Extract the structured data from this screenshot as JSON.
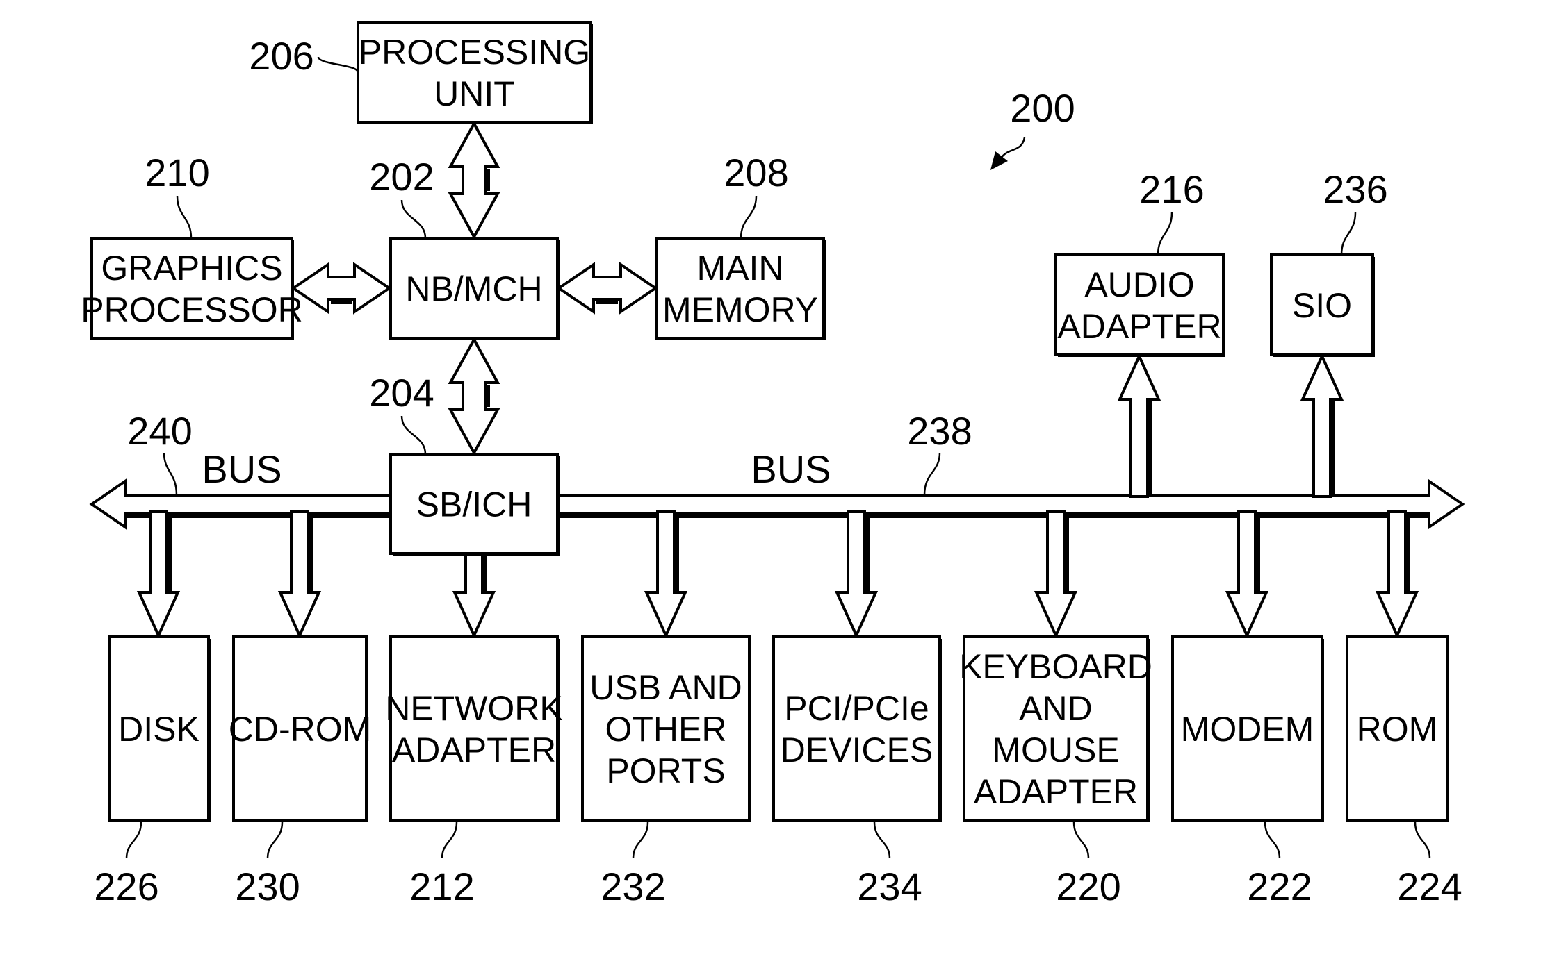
{
  "figure": {
    "ref": "200",
    "blocks": [
      {
        "id": "processing_unit",
        "ref": "206",
        "lines": [
          "PROCESSING",
          "UNIT"
        ]
      },
      {
        "id": "graphics_processor",
        "ref": "210",
        "lines": [
          "GRAPHICS",
          "PROCESSOR"
        ]
      },
      {
        "id": "nb_mch",
        "ref": "202",
        "lines": [
          "NB/MCH"
        ]
      },
      {
        "id": "main_memory",
        "ref": "208",
        "lines": [
          "MAIN",
          "MEMORY"
        ]
      },
      {
        "id": "audio_adapter",
        "ref": "216",
        "lines": [
          "AUDIO",
          "ADAPTER"
        ]
      },
      {
        "id": "sio",
        "ref": "236",
        "lines": [
          "SIO"
        ]
      },
      {
        "id": "sb_ich",
        "ref": "204",
        "lines": [
          "SB/ICH"
        ]
      },
      {
        "id": "disk",
        "ref": "226",
        "lines": [
          "DISK"
        ]
      },
      {
        "id": "cd_rom",
        "ref": "230",
        "lines": [
          "CD-ROM"
        ]
      },
      {
        "id": "network_adapter",
        "ref": "212",
        "lines": [
          "NETWORK",
          "ADAPTER"
        ]
      },
      {
        "id": "usb_ports",
        "ref": "232",
        "lines": [
          "USB AND",
          "OTHER",
          "PORTS"
        ]
      },
      {
        "id": "pci_devices",
        "ref": "234",
        "lines": [
          "PCI/PCIe",
          "DEVICES"
        ]
      },
      {
        "id": "keyboard_mouse",
        "ref": "220",
        "lines": [
          "KEYBOARD",
          "AND",
          "MOUSE",
          "ADAPTER"
        ]
      },
      {
        "id": "modem",
        "ref": "222",
        "lines": [
          "MODEM"
        ]
      },
      {
        "id": "rom",
        "ref": "224",
        "lines": [
          "ROM"
        ]
      }
    ],
    "buses": [
      {
        "id": "bus_left",
        "ref": "240",
        "label": "BUS"
      },
      {
        "id": "bus_right",
        "ref": "238",
        "label": "BUS"
      }
    ],
    "connections": [
      {
        "from": "processing_unit",
        "to": "nb_mch",
        "type": "bidirectional"
      },
      {
        "from": "graphics_processor",
        "to": "nb_mch",
        "type": "bidirectional"
      },
      {
        "from": "nb_mch",
        "to": "main_memory",
        "type": "bidirectional"
      },
      {
        "from": "nb_mch",
        "to": "sb_ich",
        "type": "bidirectional"
      },
      {
        "from": "bus",
        "to": "audio_adapter",
        "type": "unidirectional"
      },
      {
        "from": "bus",
        "to": "sio",
        "type": "unidirectional"
      },
      {
        "from": "bus",
        "to": "disk",
        "type": "unidirectional"
      },
      {
        "from": "bus",
        "to": "cd_rom",
        "type": "unidirectional"
      },
      {
        "from": "sb_ich",
        "to": "network_adapter",
        "type": "unidirectional"
      },
      {
        "from": "bus",
        "to": "usb_ports",
        "type": "unidirectional"
      },
      {
        "from": "bus",
        "to": "pci_devices",
        "type": "unidirectional"
      },
      {
        "from": "bus",
        "to": "keyboard_mouse",
        "type": "unidirectional"
      },
      {
        "from": "bus",
        "to": "modem",
        "type": "unidirectional"
      },
      {
        "from": "bus",
        "to": "rom",
        "type": "unidirectional"
      }
    ]
  }
}
